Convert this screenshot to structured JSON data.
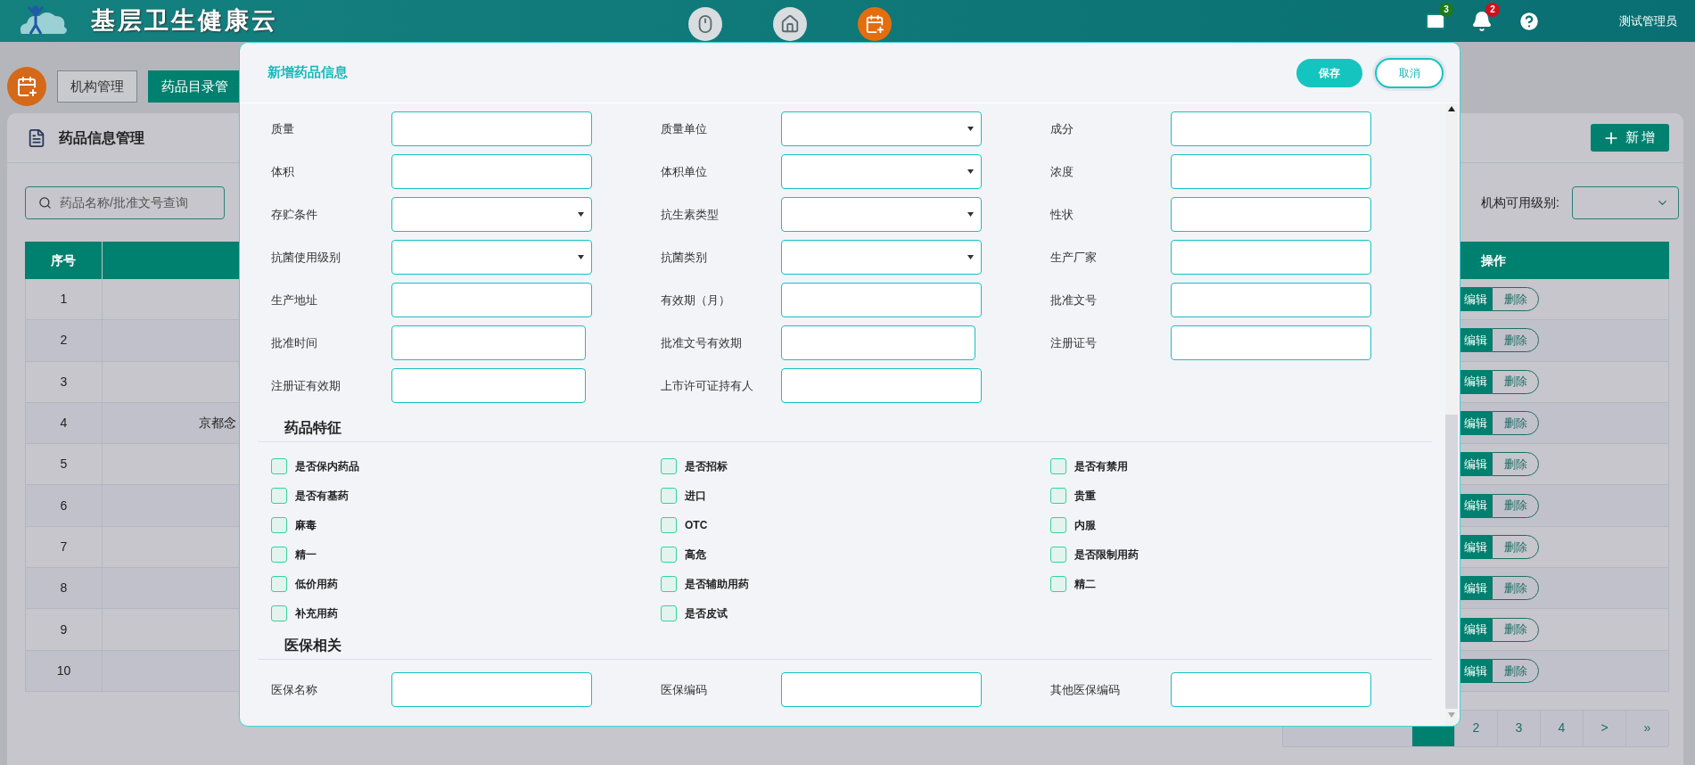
{
  "header": {
    "title": "基层卫生健康云",
    "apps": [
      {
        "kind": "mouse",
        "selected": false
      },
      {
        "kind": "house",
        "selected": false
      },
      {
        "kind": "calendar",
        "selected": true
      }
    ],
    "notifications": [
      {
        "kind": "mail",
        "count": "3",
        "color": "#1e7a1e"
      },
      {
        "kind": "bell",
        "count": "2",
        "color": "#d0101e"
      }
    ],
    "user": "测试管理员"
  },
  "nav_tabs": [
    {
      "label": "机构管理",
      "selected": false
    },
    {
      "label": "药品目录管",
      "selected": true
    }
  ],
  "page": {
    "title": "药品信息管理",
    "add_button": "新增",
    "search": {
      "placeholder": "药品名称/批准文号查询"
    },
    "filter": {
      "label": "机构可用级别:"
    },
    "table": {
      "columns": [
        "序号",
        "操作"
      ],
      "rows": [
        {
          "index": "1",
          "edit": "编辑",
          "delete": "删除"
        },
        {
          "index": "2",
          "edit": "编辑",
          "delete": "删除"
        },
        {
          "index": "3",
          "edit": "编辑",
          "delete": "删除"
        },
        {
          "index": "4",
          "column_2": "京都念",
          "edit": "编辑",
          "delete": "删除"
        },
        {
          "index": "5",
          "edit": "编辑",
          "delete": "删除"
        },
        {
          "index": "6",
          "edit": "编辑",
          "delete": "删除"
        },
        {
          "index": "7",
          "edit": "编辑",
          "delete": "删除"
        },
        {
          "index": "8",
          "edit": "编辑",
          "delete": "删除"
        },
        {
          "index": "9",
          "edit": "编辑",
          "delete": "删除"
        },
        {
          "index": "10",
          "edit": "编辑",
          "delete": "删除"
        }
      ]
    },
    "pagination": {
      "pages": [
        {
          "selected": true
        },
        {
          "label": "2",
          "selected": false
        },
        {
          "label": "3",
          "selected": false
        },
        {
          "label": "4",
          "selected": false
        }
      ],
      "next": ">",
      "last": "»"
    }
  },
  "modal": {
    "title": "新增药品信息",
    "save": "保存",
    "cancel": "取消",
    "fields": [
      {
        "label": "质量",
        "kind": "text"
      },
      {
        "label": "质量单位",
        "kind": "select"
      },
      {
        "label": "成分",
        "kind": "text"
      },
      {
        "label": "体积",
        "kind": "text"
      },
      {
        "label": "体积单位",
        "kind": "select"
      },
      {
        "label": "浓度",
        "kind": "text"
      },
      {
        "label": "存贮条件",
        "kind": "select"
      },
      {
        "label": "抗生素类型",
        "kind": "select"
      },
      {
        "label": "性状",
        "kind": "text"
      },
      {
        "label": "抗菌使用级别",
        "kind": "select"
      },
      {
        "label": "抗菌类别",
        "kind": "select"
      },
      {
        "label": "生产厂家",
        "kind": "text"
      },
      {
        "label": "生产地址",
        "kind": "text"
      },
      {
        "label": "有效期（月）",
        "kind": "text"
      },
      {
        "label": "批准文号",
        "kind": "text"
      },
      {
        "label": "批准时间",
        "kind": "date"
      },
      {
        "label": "批准文号有效期",
        "kind": "date"
      },
      {
        "label": "注册证号",
        "kind": "text"
      },
      {
        "label": "注册证有效期",
        "kind": "date"
      },
      {
        "label": "上市许可证持有人",
        "kind": "text"
      }
    ],
    "features": {
      "title": "药品特征",
      "items": [
        {
          "label": "是否保内药品",
          "checked": false
        },
        {
          "label": "是否招标",
          "checked": false
        },
        {
          "label": "是否有禁用",
          "checked": false
        },
        {
          "label": "是否有基药",
          "checked": false
        },
        {
          "label": "进口",
          "checked": false
        },
        {
          "label": "贵重",
          "checked": false
        },
        {
          "label": "麻毒",
          "checked": false
        },
        {
          "label": "OTC",
          "checked": false
        },
        {
          "label": "内服",
          "checked": false
        },
        {
          "label": "精一",
          "checked": false
        },
        {
          "label": "高危",
          "checked": false
        },
        {
          "label": "是否限制用药",
          "checked": false
        },
        {
          "label": "低价用药",
          "checked": false
        },
        {
          "label": "是否辅助用药",
          "checked": false
        },
        {
          "label": "精二",
          "checked": false
        },
        {
          "label": "补充用药",
          "checked": false
        },
        {
          "label": "是否皮试",
          "checked": false
        }
      ]
    },
    "insurance": {
      "title": "医保相关",
      "fields": [
        {
          "label": "医保名称",
          "kind": "text"
        },
        {
          "label": "医保编码",
          "kind": "text"
        },
        {
          "label": "其他医保编码",
          "kind": "text"
        }
      ]
    }
  }
}
